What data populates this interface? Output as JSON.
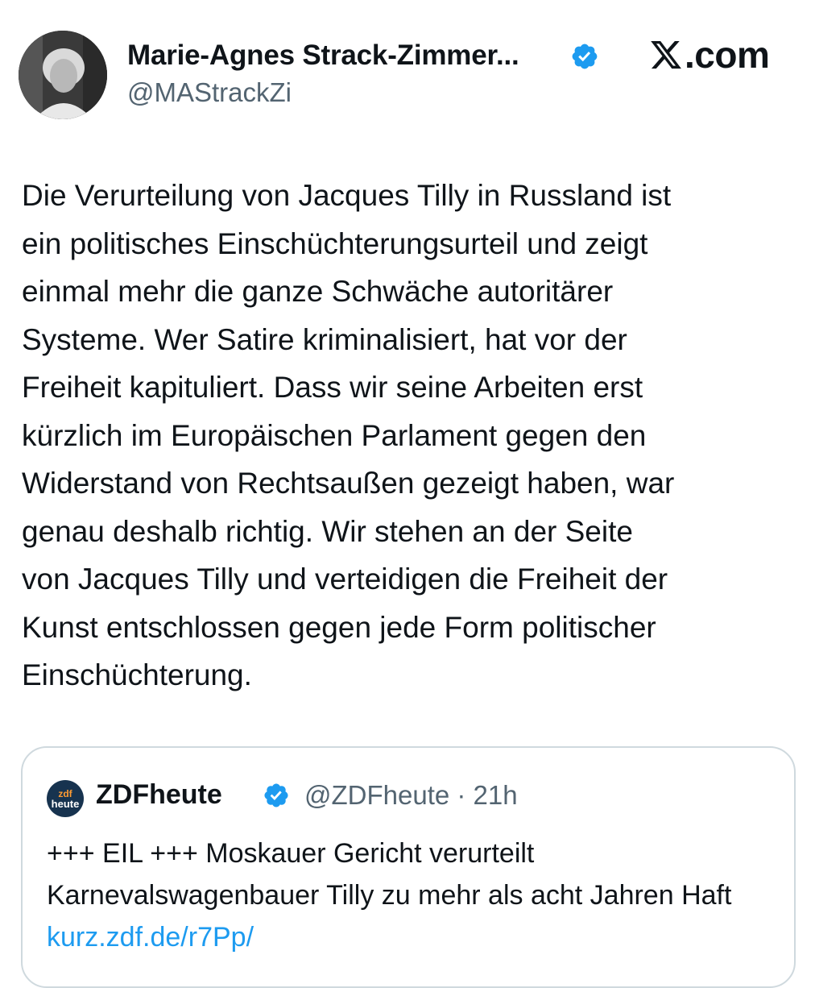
{
  "author": {
    "display_name": "Marie-Agnes Strack-Zimmer...",
    "handle": "@MAStrackZi",
    "verified": true
  },
  "brand": {
    "text": ".com",
    "icon": "x-logo-icon"
  },
  "tweet": {
    "text": "Die Verurteilung von Jacques Tilly in Russland ist\nein politisches Einschüchterungsurteil und zeigt\neinmal mehr die ganze Schwäche autoritärer\nSysteme. Wer Satire kriminalisiert, hat vor der\nFreiheit kapituliert. Dass wir seine Arbeiten erst\nkürzlich im Europäischen Parlament gegen den\nWiderstand von Rechtsaußen gezeigt haben, war\ngenau deshalb richtig. Wir stehen an der Seite\nvon Jacques Tilly und verteidigen die Freiheit der\nKunst entschlossen gegen jede Form politischer\nEinschüchterung."
  },
  "quoted_tweet": {
    "avatar_line1": "zdf",
    "avatar_line2": "heute",
    "display_name": "ZDFheute",
    "handle_time": "@ZDFheute · 21h",
    "text": "+++ EIL +++ Moskauer Gericht verurteilt Karnevalswagenbauer Tilly zu mehr als acht Jahren Haft ",
    "link": "kurz.zdf.de/r7Pp/"
  },
  "colors": {
    "verified": "#1d9bf0",
    "link": "#1d9bf0",
    "secondary_text": "#536471",
    "card_border": "#cfd9de"
  }
}
